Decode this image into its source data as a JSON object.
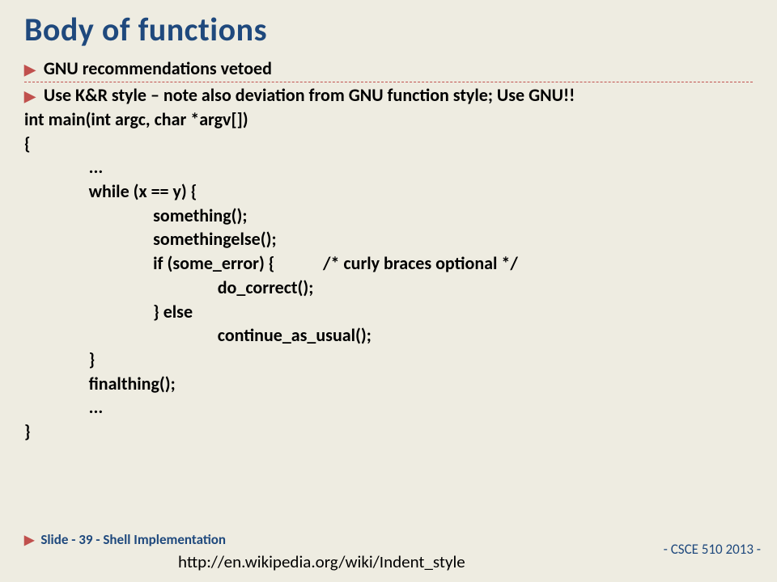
{
  "title": "Body of functions",
  "bullets": [
    "GNU recommendations vetoed",
    "Use K&R style – note also deviation from GNU function style; Use GNU!!"
  ],
  "code": "int main(int argc, char *argv[])\n{\n                ...\n                while (x == y) {\n                                something();\n                                somethingelse();\n                                if (some_error) {            /* curly braces optional */\n                                                do_correct();\n                                } else\n                                                continue_as_usual();\n                }\n                finalthing();\n                ...\n}",
  "footer": {
    "left": "Slide - 39 -  Shell Implementation",
    "url": "http://en.wikipedia.org/wiki/Indent_style",
    "right": "- CSCE 510 2013 -"
  }
}
